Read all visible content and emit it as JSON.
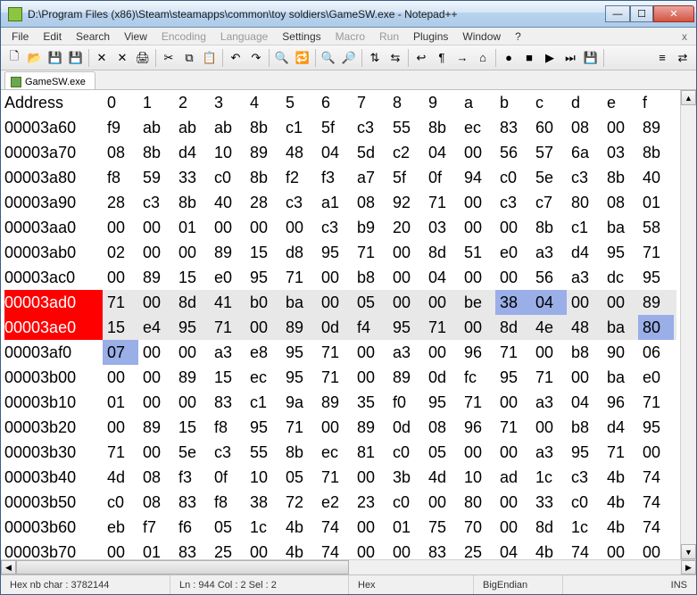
{
  "titlebar": {
    "title": "D:\\Program Files (x86)\\Steam\\steamapps\\common\\toy soldiers\\GameSW.exe - Notepad++"
  },
  "menubar": {
    "items": [
      "File",
      "Edit",
      "Search",
      "View",
      "Encoding",
      "Language",
      "Settings",
      "Macro",
      "Run",
      "Plugins",
      "Window",
      "?"
    ],
    "dim_indices": [
      4,
      5,
      7,
      8
    ]
  },
  "tab": {
    "label": "GameSW.exe"
  },
  "hex": {
    "header_addr": "Address",
    "header_cols": [
      "0",
      "1",
      "2",
      "3",
      "4",
      "5",
      "6",
      "7",
      "8",
      "9",
      "a",
      "b",
      "c",
      "d",
      "e",
      "f"
    ],
    "rows": [
      {
        "addr": "00003a60",
        "bytes": [
          "f9",
          "ab",
          "ab",
          "ab",
          "8b",
          "c1",
          "5f",
          "c3",
          "55",
          "8b",
          "ec",
          "83",
          "60",
          "08",
          "00",
          "89"
        ]
      },
      {
        "addr": "00003a70",
        "bytes": [
          "08",
          "8b",
          "d4",
          "10",
          "89",
          "48",
          "04",
          "5d",
          "c2",
          "04",
          "00",
          "56",
          "57",
          "6a",
          "03",
          "8b"
        ]
      },
      {
        "addr": "00003a80",
        "bytes": [
          "f8",
          "59",
          "33",
          "c0",
          "8b",
          "f2",
          "f3",
          "a7",
          "5f",
          "0f",
          "94",
          "c0",
          "5e",
          "c3",
          "8b",
          "40"
        ]
      },
      {
        "addr": "00003a90",
        "bytes": [
          "28",
          "c3",
          "8b",
          "40",
          "28",
          "c3",
          "a1",
          "08",
          "92",
          "71",
          "00",
          "c3",
          "c7",
          "80",
          "08",
          "01"
        ]
      },
      {
        "addr": "00003aa0",
        "bytes": [
          "00",
          "00",
          "01",
          "00",
          "00",
          "00",
          "c3",
          "b9",
          "20",
          "03",
          "00",
          "00",
          "8b",
          "c1",
          "ba",
          "58"
        ]
      },
      {
        "addr": "00003ab0",
        "bytes": [
          "02",
          "00",
          "00",
          "89",
          "15",
          "d8",
          "95",
          "71",
          "00",
          "8d",
          "51",
          "e0",
          "a3",
          "d4",
          "95",
          "71"
        ]
      },
      {
        "addr": "00003ac0",
        "bytes": [
          "00",
          "89",
          "15",
          "e0",
          "95",
          "71",
          "00",
          "b8",
          "00",
          "04",
          "00",
          "00",
          "56",
          "a3",
          "dc",
          "95"
        ]
      },
      {
        "addr": "00003ad0",
        "bytes": [
          "71",
          "00",
          "8d",
          "41",
          "b0",
          "ba",
          "00",
          "05",
          "00",
          "00",
          "be",
          "38",
          "04",
          "00",
          "00",
          "89"
        ],
        "selRow": true,
        "selCells": [
          11,
          12
        ]
      },
      {
        "addr": "00003ae0",
        "bytes": [
          "15",
          "e4",
          "95",
          "71",
          "00",
          "89",
          "0d",
          "f4",
          "95",
          "71",
          "00",
          "8d",
          "4e",
          "48",
          "ba",
          "80"
        ],
        "selRow": true,
        "selCells": [
          15
        ]
      },
      {
        "addr": "00003af0",
        "bytes": [
          "07",
          "00",
          "00",
          "a3",
          "e8",
          "95",
          "71",
          "00",
          "a3",
          "00",
          "96",
          "71",
          "00",
          "b8",
          "90",
          "06"
        ],
        "selCells": [
          0
        ]
      },
      {
        "addr": "00003b00",
        "bytes": [
          "00",
          "00",
          "89",
          "15",
          "ec",
          "95",
          "71",
          "00",
          "89",
          "0d",
          "fc",
          "95",
          "71",
          "00",
          "ba",
          "e0"
        ]
      },
      {
        "addr": "00003b10",
        "bytes": [
          "01",
          "00",
          "00",
          "83",
          "c1",
          "9a",
          "89",
          "35",
          "f0",
          "95",
          "71",
          "00",
          "a3",
          "04",
          "96",
          "71"
        ]
      },
      {
        "addr": "00003b20",
        "bytes": [
          "00",
          "89",
          "15",
          "f8",
          "95",
          "71",
          "00",
          "89",
          "0d",
          "08",
          "96",
          "71",
          "00",
          "b8",
          "d4",
          "95"
        ]
      },
      {
        "addr": "00003b30",
        "bytes": [
          "71",
          "00",
          "5e",
          "c3",
          "55",
          "8b",
          "ec",
          "81",
          "c0",
          "05",
          "00",
          "00",
          "a3",
          "95",
          "71",
          "00"
        ]
      },
      {
        "addr": "00003b40",
        "bytes": [
          "4d",
          "08",
          "f3",
          "0f",
          "10",
          "05",
          "71",
          "00",
          "3b",
          "4d",
          "10",
          "ad",
          "1c",
          "c3",
          "4b",
          "74"
        ]
      },
      {
        "addr": "00003b50",
        "bytes": [
          "c0",
          "08",
          "83",
          "f8",
          "38",
          "72",
          "e2",
          "23",
          "c0",
          "00",
          "80",
          "00",
          "33",
          "c0",
          "4b",
          "74"
        ]
      },
      {
        "addr": "00003b60",
        "bytes": [
          "eb",
          "f7",
          "f6",
          "05",
          "1c",
          "4b",
          "74",
          "00",
          "01",
          "75",
          "70",
          "00",
          "8d",
          "1c",
          "4b",
          "74"
        ]
      },
      {
        "addr": "00003b70",
        "bytes": [
          "00",
          "01",
          "83",
          "25",
          "00",
          "4b",
          "74",
          "00",
          "00",
          "83",
          "25",
          "04",
          "4b",
          "74",
          "00",
          "00"
        ]
      }
    ]
  },
  "statusbar": {
    "s1_label": "Hex  nb char :",
    "s1_value": "3782144",
    "s2": "Ln : 944    Col : 2    Sel : 2",
    "s3": "Hex",
    "s4": "BigEndian",
    "s5": "INS"
  },
  "toolbar_icons": [
    "new-file-icon",
    "open-file-icon",
    "save-icon",
    "save-all-icon",
    "sep",
    "close-icon",
    "close-all-icon",
    "print-icon",
    "sep",
    "cut-icon",
    "copy-icon",
    "paste-icon",
    "sep",
    "undo-icon",
    "redo-icon",
    "sep",
    "find-icon",
    "replace-icon",
    "sep",
    "zoom-in-icon",
    "zoom-out-icon",
    "sep",
    "sync-v-icon",
    "sync-h-icon",
    "sep",
    "wrap-icon",
    "chars-icon",
    "indent-icon",
    "lang-icon",
    "sep",
    "record-macro-icon",
    "stop-macro-icon",
    "play-macro-icon",
    "play-multi-icon",
    "save-macro-icon",
    "sep",
    "spacer",
    "hex-toggle-icon",
    "compare-icon"
  ],
  "icon_glyphs": {
    "new-file-icon": "🗋",
    "open-file-icon": "📂",
    "save-icon": "💾",
    "save-all-icon": "💾",
    "close-icon": "✕",
    "close-all-icon": "✕",
    "print-icon": "🖨",
    "cut-icon": "✂",
    "copy-icon": "⧉",
    "paste-icon": "📋",
    "undo-icon": "↶",
    "redo-icon": "↷",
    "find-icon": "🔍",
    "replace-icon": "🔁",
    "zoom-in-icon": "🔍",
    "zoom-out-icon": "🔎",
    "sync-v-icon": "⇅",
    "sync-h-icon": "⇆",
    "wrap-icon": "↩",
    "chars-icon": "¶",
    "indent-icon": "→",
    "lang-icon": "⌂",
    "record-macro-icon": "●",
    "stop-macro-icon": "■",
    "play-macro-icon": "▶",
    "play-multi-icon": "⏭",
    "save-macro-icon": "💾",
    "hex-toggle-icon": "≡",
    "compare-icon": "⇄"
  }
}
